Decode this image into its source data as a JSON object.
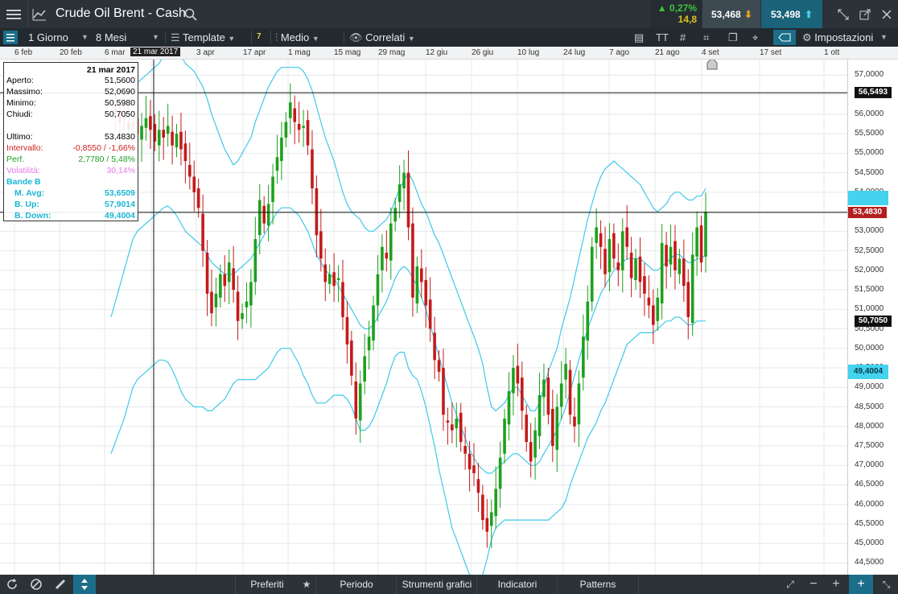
{
  "window": {
    "title": "Crude Oil Brent - Cash"
  },
  "quote": {
    "change_pct": "0,27%",
    "change_abs": "14,8",
    "sell": "53,468",
    "buy": "53,498"
  },
  "toolbar": {
    "interval": "1 Giorno",
    "range": "8 Mesi",
    "template": "Template",
    "badge": "7",
    "chart_type": "Medio",
    "related": "Correlati",
    "settings": "Impostazioni"
  },
  "timeline": {
    "labels": [
      "6 feb",
      "20 feb",
      "6 mar",
      "21 mar 2017",
      "3 apr",
      "17 apr",
      "1 mag",
      "15 mag",
      "29 mag",
      "12 giu",
      "26 giu",
      "10 lug",
      "24 lug",
      "7 ago",
      "21 ago",
      "4 set",
      "17 set",
      "1 ott"
    ],
    "selected_index": 3
  },
  "info_panel": {
    "date": "21 mar 2017",
    "rows": [
      {
        "k": "Aperto:",
        "v": "51,5600",
        "color": "#000000"
      },
      {
        "k": "Massimo:",
        "v": "52,0690",
        "color": "#000000"
      },
      {
        "k": "Minimo:",
        "v": "50,5980",
        "color": "#000000"
      },
      {
        "k": "Chiudi:",
        "v": "50,7050",
        "color": "#000000"
      },
      {
        "k": "Ultimo:",
        "v": "53,4830",
        "color": "#000000"
      },
      {
        "k": "Intervallo:",
        "v": "-0,8550 / -1,66%",
        "color": "#d12020"
      },
      {
        "k": "Perf.",
        "v": "2,7780 / 5,48%",
        "color": "#20a020"
      },
      {
        "k": "Volatilità:",
        "v": "30,14%",
        "color": "#e879e8"
      },
      {
        "k": "Bande B",
        "v": "",
        "color": "#19b6d6"
      },
      {
        "k": "M. Avg:",
        "v": "53,6509",
        "color": "#19b6d6"
      },
      {
        "k": "B. Up:",
        "v": "57,9014",
        "color": "#19b6d6"
      },
      {
        "k": "B. Down:",
        "v": "49,4004",
        "color": "#19b6d6"
      }
    ]
  },
  "price_axis": {
    "ticks": [
      "57,0000",
      "56,5000",
      "56,0000",
      "55,5000",
      "55,0000",
      "54,5000",
      "54,0000",
      "53,5000",
      "53,0000",
      "52,5000",
      "52,0000",
      "51,5000",
      "51,0000",
      "50,5000",
      "50,0000",
      "49,5000",
      "49,0000",
      "48,5000",
      "48,0000",
      "47,5000",
      "47,0000",
      "46,5000",
      "46,0000",
      "45,5000",
      "45,0000",
      "44,5000"
    ],
    "tick_values": [
      57,
      56.5,
      56,
      55.5,
      55,
      54.5,
      54,
      53.5,
      53,
      52.5,
      52,
      51.5,
      51,
      50.5,
      50,
      49.5,
      49,
      48.5,
      48,
      47.5,
      47,
      46.5,
      46,
      45.5,
      45,
      44.5
    ],
    "high_tag": "56,5493",
    "last_tag": "53,4830",
    "close_tag": "50,7050",
    "bdown_tag": "49,4004"
  },
  "chart_data": {
    "type": "candlestick",
    "title": "",
    "ylim": [
      44.2,
      57.4
    ],
    "high_line": 56.5493,
    "last_price": 53.483,
    "crosshair_date": "21 mar 2017",
    "candle_colors": {
      "up": "#1ea01e",
      "down": "#c41a1a"
    },
    "band_color": "#3fc9e8",
    "closes": [
      56.2,
      56.0,
      55.8,
      55.9,
      55.6,
      55.8,
      55.5,
      55.7,
      55.9,
      55.6,
      55.3,
      55.6,
      55.4,
      55.7,
      55.2,
      55.5,
      55.1,
      54.8,
      54.4,
      54.0,
      53.6,
      52.5,
      51.4,
      50.9,
      51.4,
      51.9,
      51.6,
      52.2,
      51.5,
      50.7,
      50.9,
      51.2,
      51.7,
      52.8,
      53.8,
      53.2,
      53.7,
      54.4,
      54.9,
      55.4,
      55.8,
      56.3,
      55.8,
      55.6,
      55.7,
      55.2,
      54.1,
      52.9,
      52.3,
      51.7,
      51.9,
      51.6,
      51.8,
      50.8,
      50.1,
      49.3,
      48.2,
      49.1,
      49.8,
      50.3,
      51.1,
      51.9,
      52.6,
      52.3,
      53.2,
      53.6,
      54.2,
      54.5,
      53.1,
      51.3,
      52.1,
      51.7,
      51.1,
      50.5,
      49.7,
      49.4,
      48.3,
      48.1,
      47.9,
      48.2,
      47.6,
      47.3,
      46.9,
      46.8,
      46.3,
      45.6,
      45.3,
      45.8,
      46.4,
      47.2,
      48.2,
      48.9,
      49.5,
      49.1,
      48.4,
      47.6,
      47.1,
      47.9,
      48.8,
      49.2,
      48.3,
      47.5,
      48.5,
      49.1,
      49.6,
      48.3,
      48.0,
      49.1,
      50.3,
      51.2,
      52.6,
      53.1,
      52.6,
      51.9,
      52.8,
      52.3,
      52.0,
      53.0,
      52.6,
      51.8,
      52.3,
      51.7,
      51.4,
      51.1,
      50.6,
      51.3,
      52.7,
      52.1,
      52.6,
      52.0,
      52.3,
      51.6,
      50.8,
      52.4,
      53.1,
      52.2,
      53.5
    ],
    "mid_band": [
      50.8,
      51.2,
      51.6,
      52.0,
      52.4,
      52.8,
      53.0,
      53.1,
      53.2,
      53.3,
      53.4,
      53.5,
      53.6,
      53.65,
      53.55,
      53.4,
      53.2,
      53.0,
      52.9,
      52.8,
      52.7,
      52.6,
      52.4,
      52.2,
      52.1,
      52.0,
      51.9,
      51.9,
      51.9,
      52.0,
      52.1,
      52.2,
      52.3,
      52.5,
      52.7,
      52.9,
      53.1,
      53.3,
      53.5,
      53.6,
      53.6,
      53.6,
      53.5,
      53.4,
      53.2,
      53.0,
      52.7,
      52.4,
      52.2,
      52.0,
      51.9,
      51.8,
      51.6,
      51.4,
      51.2,
      51.0,
      50.8,
      50.6,
      50.5,
      50.5,
      50.6,
      50.8,
      51.0,
      51.2,
      51.5,
      51.8,
      52.0,
      52.1,
      52.0,
      51.8,
      51.6,
      51.3,
      51.0,
      50.6,
      50.2,
      49.8,
      49.4,
      49.0,
      48.6,
      48.3,
      48.0,
      47.7,
      47.4,
      47.2,
      47.0,
      46.9,
      46.8,
      46.8,
      46.9,
      47.0,
      47.1,
      47.2,
      47.3,
      47.3,
      47.2,
      47.1,
      47.0,
      47.0,
      47.1,
      47.3,
      47.5,
      47.7,
      47.9,
      48.2,
      48.5,
      48.9,
      49.3,
      49.7,
      50.1,
      50.5,
      50.8,
      51.1,
      51.4,
      51.6,
      51.8,
      52.0,
      52.1,
      52.2,
      52.3,
      52.3,
      52.3,
      52.3,
      52.2,
      52.1,
      52.0,
      52.0,
      52.1,
      52.2,
      52.3,
      52.4,
      52.4,
      52.3,
      52.2,
      52.2,
      52.3,
      52.3,
      52.4
    ],
    "band_width": [
      3.5,
      3.6,
      3.7,
      3.8,
      3.8,
      3.8,
      3.8,
      3.8,
      3.8,
      3.8,
      3.8,
      3.8,
      3.9,
      4.0,
      4.1,
      4.2,
      4.3,
      4.3,
      4.3,
      4.3,
      4.2,
      4.1,
      4.0,
      3.8,
      3.6,
      3.4,
      3.2,
      3.0,
      2.8,
      2.8,
      2.9,
      3.0,
      3.1,
      3.3,
      3.4,
      3.5,
      3.6,
      3.6,
      3.6,
      3.6,
      3.6,
      3.6,
      3.7,
      3.8,
      3.9,
      3.9,
      3.9,
      3.8,
      3.6,
      3.4,
      3.2,
      3.0,
      2.8,
      2.6,
      2.5,
      2.5,
      2.6,
      2.7,
      2.6,
      2.5,
      2.4,
      2.3,
      2.2,
      2.1,
      2.0,
      2.0,
      2.1,
      2.2,
      2.5,
      2.5,
      2.4,
      2.4,
      2.5,
      2.6,
      2.7,
      2.9,
      3.0,
      3.1,
      3.2,
      3.2,
      3.2,
      3.2,
      3.2,
      3.1,
      3.0,
      2.7,
      2.2,
      1.7,
      1.5,
      1.5,
      1.5,
      1.6,
      1.7,
      1.7,
      1.6,
      1.5,
      1.4,
      1.4,
      1.5,
      1.7,
      1.9,
      2.0,
      2.1,
      2.3,
      2.4,
      2.4,
      2.5,
      2.6,
      2.7,
      2.8,
      2.9,
      3.0,
      3.0,
      3.0,
      2.9,
      2.8,
      2.6,
      2.4,
      2.2,
      2.1,
      2.0,
      1.9,
      1.8,
      1.7,
      1.6,
      1.5,
      1.5,
      1.5,
      1.6,
      1.6,
      1.6,
      1.6,
      1.6,
      1.6,
      1.6,
      1.6,
      1.7
    ]
  },
  "bottom": {
    "tabs": [
      "Preferiti",
      "Periodo",
      "Strumenti grafici",
      "Indicatori",
      "Patterns"
    ]
  }
}
